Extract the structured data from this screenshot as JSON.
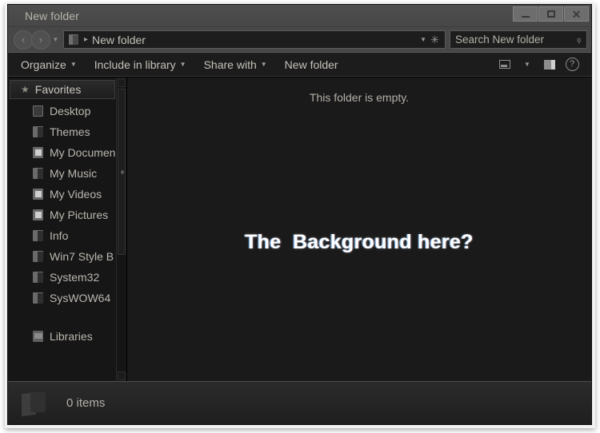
{
  "window": {
    "title": "New folder",
    "caption_buttons": [
      {
        "name": "minimize",
        "glyph": "—"
      },
      {
        "name": "maximize",
        "glyph": "□"
      },
      {
        "name": "close",
        "glyph": "✕"
      }
    ]
  },
  "address_bar": {
    "back_glyph": "‹",
    "forward_glyph": "›",
    "recent_glyph": "▼",
    "breadcrumb_separator": "▸",
    "breadcrumb": "New folder",
    "dropdown_glyph": "▼",
    "refresh_glyph": "✳",
    "folder_icon": "folder-icon"
  },
  "search": {
    "placeholder": "Search New folder",
    "value": "",
    "icon_glyph": "⌕"
  },
  "toolbar": {
    "items": [
      {
        "label": "Organize",
        "has_caret": true
      },
      {
        "label": "Include in library",
        "has_caret": true
      },
      {
        "label": "Share with",
        "has_caret": true
      },
      {
        "label": "New folder",
        "has_caret": false
      }
    ],
    "caret_glyph": "▼",
    "help_glyph": "?"
  },
  "sidebar": {
    "groups": [
      {
        "header": "Favorites",
        "header_icon": "star-icon",
        "star_glyph": "★",
        "items": [
          {
            "label": "Desktop",
            "icon": "desktop-icon"
          },
          {
            "label": "Themes",
            "icon": "folder-icon"
          },
          {
            "label": "My Documen",
            "icon": "document-folder-icon"
          },
          {
            "label": "My Music",
            "icon": "folder-icon"
          },
          {
            "label": "My Videos",
            "icon": "document-folder-icon"
          },
          {
            "label": "My Pictures",
            "icon": "document-folder-icon"
          },
          {
            "label": "Info",
            "icon": "folder-icon"
          },
          {
            "label": "Win7 Style B",
            "icon": "folder-icon"
          },
          {
            "label": "System32",
            "icon": "folder-icon"
          },
          {
            "label": "SysWOW64",
            "icon": "folder-icon"
          }
        ]
      },
      {
        "header": "Libraries",
        "header_icon": "library-icon",
        "items": []
      }
    ]
  },
  "content": {
    "empty_message": "This folder is empty.",
    "overlay_text": "The  Background here?"
  },
  "status_bar": {
    "item_count": "0 items",
    "folder_icon": "folder-icon"
  },
  "colors": {
    "window_chrome": "#474747",
    "toolbar_bg": "#1c1c1c",
    "content_bg": "#1a1a1a",
    "sidebar_bg": "#161616",
    "text_primary": "#c3c0b9",
    "text_secondary": "#b4b0a9",
    "overlay_text": "#ffffff"
  }
}
